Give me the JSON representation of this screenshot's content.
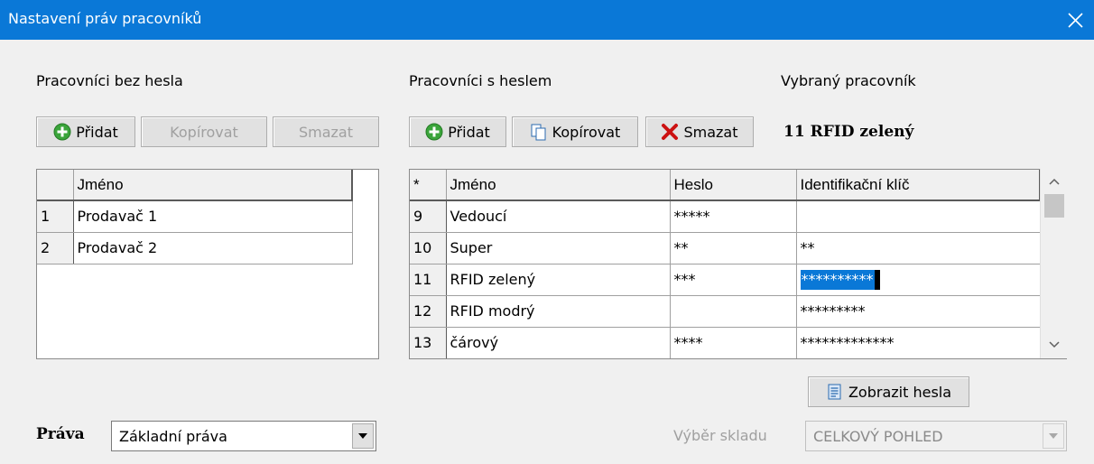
{
  "window": {
    "title": "Nastavení práv pracovníků",
    "close_glyph": "✕"
  },
  "left_panel": {
    "heading": "Pracovníci bez hesla",
    "buttons": {
      "add": "Přidat",
      "copy": "Kopírovat",
      "delete": "Smazat"
    },
    "table": {
      "headers": [
        "",
        "Jméno"
      ],
      "rows": [
        {
          "num": "1",
          "name": "Prodavač 1"
        },
        {
          "num": "2",
          "name": "Prodavač 2"
        }
      ]
    }
  },
  "right_panel": {
    "heading": "Pracovníci s heslem",
    "buttons": {
      "add": "Přidat",
      "copy": "Kopírovat",
      "delete": "Smazat"
    },
    "table": {
      "headers": [
        "*",
        "Jméno",
        "Heslo",
        "Identifikační klíč"
      ],
      "rows": [
        {
          "num": "9",
          "name": "Vedoucí",
          "password": "*****",
          "key": ""
        },
        {
          "num": "10",
          "name": "Super",
          "password": "**",
          "key": "**"
        },
        {
          "num": "11",
          "name": "RFID zelený",
          "password": "***",
          "key": "**********"
        },
        {
          "num": "12",
          "name": "RFID modrý",
          "password": "",
          "key": "*********"
        },
        {
          "num": "13",
          "name": "čárový",
          "password": "****",
          "key": "*************"
        }
      ]
    },
    "show_passwords_button": "Zobrazit hesla"
  },
  "selected_worker": {
    "heading": "Vybraný pracovník",
    "value": "11 RFID zelený"
  },
  "rights": {
    "label": "Práva",
    "value": "Základní práva"
  },
  "warehouse": {
    "label": "Výběr skladu",
    "value": "CELKOVÝ POHLED"
  },
  "colors": {
    "titlebar": "#0a78d7",
    "selection": "#0a78d7",
    "add_icon": "#3aa43a",
    "delete_icon": "#cc1111"
  },
  "icons": {
    "add": "plus-circle-icon",
    "copy": "copy-pages-icon",
    "delete": "red-x-icon",
    "show_passwords": "document-list-icon",
    "close": "close-icon",
    "dropdown": "chevron-down-icon"
  }
}
